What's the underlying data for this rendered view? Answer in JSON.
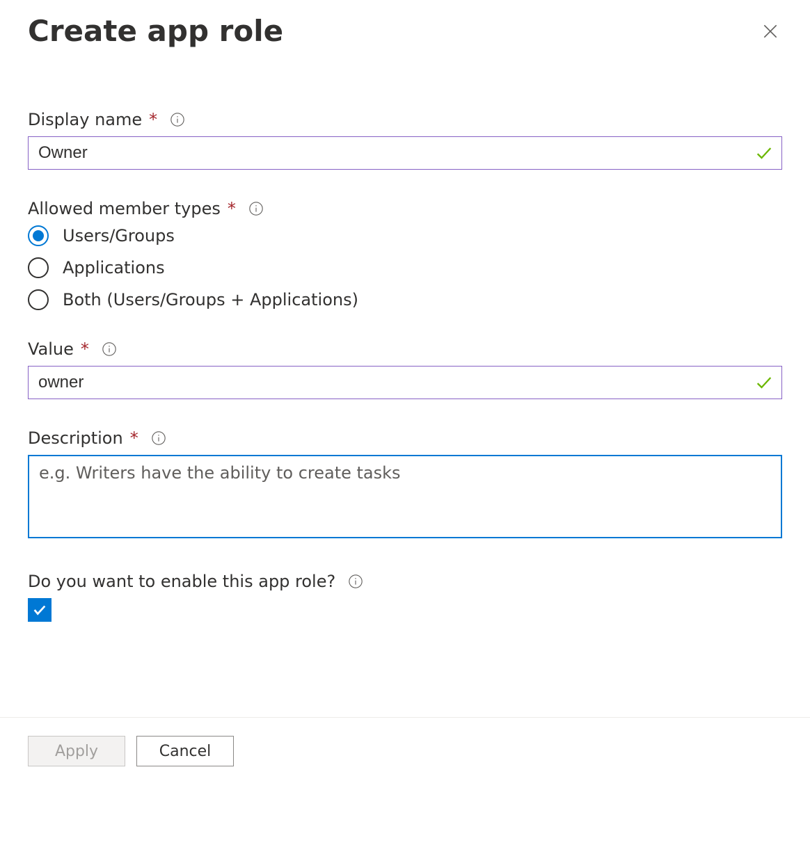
{
  "header": {
    "title": "Create app role"
  },
  "displayName": {
    "label": "Display name",
    "value": "Owner"
  },
  "allowedMemberTypes": {
    "label": "Allowed member types",
    "options": {
      "usersGroups": "Users/Groups",
      "applications": "Applications",
      "both": "Both (Users/Groups + Applications)"
    },
    "selected": "usersGroups"
  },
  "value": {
    "label": "Value",
    "value": "owner"
  },
  "description": {
    "label": "Description",
    "placeholder": "e.g. Writers have the ability to create tasks",
    "value": ""
  },
  "enable": {
    "label": "Do you want to enable this app role?",
    "checked": true
  },
  "footer": {
    "apply": "Apply",
    "cancel": "Cancel"
  }
}
